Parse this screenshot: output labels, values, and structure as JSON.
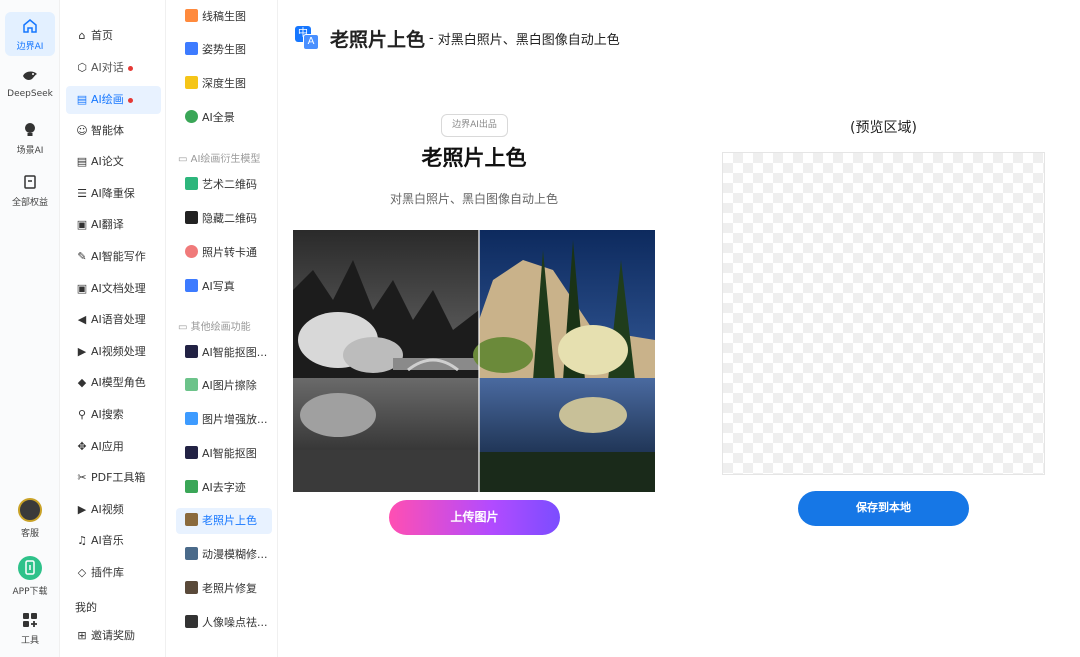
{
  "rail": {
    "items": [
      {
        "label": "边界AI",
        "icon": "home-icon"
      },
      {
        "label": "DeepSeek",
        "icon": "deepseek-whale-icon"
      },
      {
        "label": "场景AI",
        "icon": "lightbulb-icon"
      },
      {
        "label": "全部权益",
        "icon": "bookmark-icon"
      },
      {
        "label": "客服",
        "icon": "customer-service-avatar-icon"
      },
      {
        "label": "APP下载",
        "icon": "app-download-icon"
      },
      {
        "label": "工具",
        "icon": "tools-grid-icon"
      }
    ]
  },
  "menu": {
    "items": [
      {
        "label": "首页",
        "glyph": "⌂"
      },
      {
        "label": "AI对话",
        "glyph": "⬡"
      },
      {
        "label": "AI绘画",
        "glyph": "▤"
      },
      {
        "label": "智能体",
        "glyph": "☺"
      },
      {
        "label": "AI论文",
        "glyph": "▤"
      },
      {
        "label": "AI降重保",
        "glyph": "☰"
      },
      {
        "label": "AI翻译",
        "glyph": "▣"
      },
      {
        "label": "AI智能写作",
        "glyph": "✎"
      },
      {
        "label": "AI文档处理",
        "glyph": "▣"
      },
      {
        "label": "AI语音处理",
        "glyph": "◀"
      },
      {
        "label": "AI视频处理",
        "glyph": "▶"
      },
      {
        "label": "AI模型角色",
        "glyph": "◆"
      },
      {
        "label": "AI搜索",
        "glyph": "⚲"
      },
      {
        "label": "AI应用",
        "glyph": "✥"
      },
      {
        "label": "PDF工具箱",
        "glyph": "✂"
      },
      {
        "label": "AI视频",
        "glyph": "▶"
      },
      {
        "label": "AI音乐",
        "glyph": "♫"
      },
      {
        "label": "插件库",
        "glyph": "◇"
      }
    ],
    "mine": "我的",
    "invite": "邀请奖励"
  },
  "submenu": {
    "items_top": [
      {
        "label": "线稿生图",
        "color": "#ff8a3d"
      },
      {
        "label": "姿势生图",
        "color": "#3d7bff"
      },
      {
        "label": "深度生图",
        "color": "#f5c518"
      },
      {
        "label": "AI全景",
        "color": "#3aa657"
      }
    ],
    "heading1": "AI绘画衍生模型",
    "items_mid": [
      {
        "label": "艺术二维码",
        "color": "#2db67c"
      },
      {
        "label": "隐藏二维码",
        "color": "#222222"
      },
      {
        "label": "照片转卡通",
        "color": "#f07a7a"
      },
      {
        "label": "AI写真",
        "color": "#3d7bff"
      }
    ],
    "heading2": "其他绘画功能",
    "items_bottom": [
      {
        "label": "AI智能抠图...",
        "color": "#222244"
      },
      {
        "label": "AI图片擦除",
        "color": "#6cc38a"
      },
      {
        "label": "图片增强放...",
        "color": "#3d9bff"
      },
      {
        "label": "AI智能抠图",
        "color": "#222244"
      },
      {
        "label": "AI去字迹",
        "color": "#3aa657"
      },
      {
        "label": "老照片上色",
        "color": "#8a6a3d"
      },
      {
        "label": "动漫模糊修...",
        "color": "#4a6a8a"
      },
      {
        "label": "老照片修复",
        "color": "#5a4a3a"
      },
      {
        "label": "人像噪点祛...",
        "color": "#333333"
      }
    ]
  },
  "header": {
    "icon_a": "中",
    "icon_b": "A",
    "title": "老照片上色",
    "separator": "-",
    "subtitle": "对黑白照片、黑白图像自动上色"
  },
  "feature": {
    "badge": "边界AI出品",
    "title": "老照片上色",
    "description": "对黑白照片、黑白图像自动上色",
    "upload_label": "上传图片"
  },
  "preview": {
    "label": "(预览区域)",
    "save_label": "保存到本地"
  },
  "colors": {
    "accent": "#1677ff",
    "upload_gradient_start": "#ff4fb2",
    "upload_gradient_end": "#7b4dff",
    "save_button": "#1677e6"
  }
}
